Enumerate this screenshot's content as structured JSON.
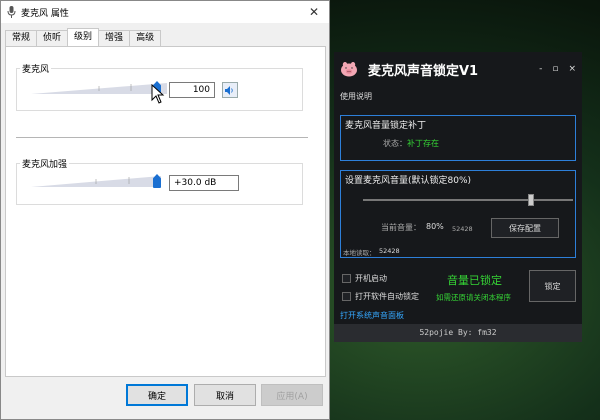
{
  "left_window": {
    "title": "麦克风 属性",
    "close_label": "✕",
    "tabs": [
      "常规",
      "侦听",
      "级别",
      "增强",
      "高级"
    ],
    "active_tab": "级别",
    "mic_group": {
      "label": "麦克风",
      "value": "100",
      "level": 1.0
    },
    "boost_group": {
      "label": "麦克风加强",
      "value": "+30.0 dB",
      "level": 1.0
    },
    "buttons": {
      "ok": "确定",
      "cancel": "取消",
      "apply": "应用(A)"
    }
  },
  "right_window": {
    "title": "麦克风声音锁定V1",
    "controls": {
      "minimize": "-",
      "restore": "▫",
      "close": "×"
    },
    "help": "使用说明",
    "patch_panel": {
      "title": "麦克风音量锁定补丁",
      "status_label": "状态：",
      "status_value": "补丁存在"
    },
    "volume_panel": {
      "title": "设置麦克风音量(默认锁定80%)",
      "current_label": "当前音量：",
      "current_percent": "80%",
      "current_raw": "52428",
      "save_button": "保存配置",
      "local_read_label": "本地读取：",
      "local_read_value": "52428",
      "slider_level": 0.8
    },
    "options": {
      "autostart": "开机启动",
      "auto_lock": "打开软件自动锁定"
    },
    "locked_status": "音量已锁定",
    "restore_hint": "如需还原请关闭本程序",
    "lock_button": "锁定",
    "open_panel_link": "打开系统声音面板",
    "footer": "52pojie By: fm32"
  },
  "colors": {
    "accent_blue": "#0078d7",
    "panel_border": "#2d7fd9",
    "status_green": "#35d435",
    "link_blue": "#35a8ff"
  }
}
